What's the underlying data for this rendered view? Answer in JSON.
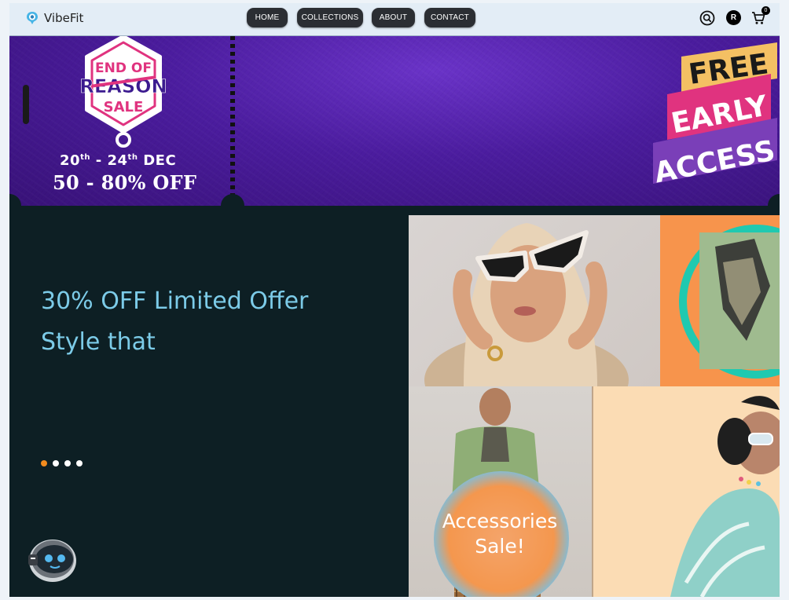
{
  "brand": {
    "name": "VibeFit"
  },
  "nav": {
    "items": [
      {
        "label": "HOME"
      },
      {
        "label": "COLLECTIONS"
      },
      {
        "label": "ABOUT"
      },
      {
        "label": "CONTACT"
      }
    ],
    "avatar_initial": "R",
    "cart_count": "0",
    "icons": [
      "search-icon",
      "cart-icon"
    ]
  },
  "banner": {
    "sale_title_line1": "END OF",
    "sale_title_line2": "REASON",
    "sale_title_line3": "SALE",
    "date_start": "20",
    "date_start_suffix": "th",
    "date_sep": " - ",
    "date_end": "24",
    "date_end_suffix": "th",
    "date_month": " DEC",
    "discount": "50 - 80% OFF",
    "badge_line1": "FREE",
    "badge_line2": "EARLY",
    "badge_line3": "ACCESS",
    "colors": {
      "purple": "#4b1c9e",
      "pink": "#e0337f",
      "yellow": "#f4c063",
      "violet": "#7a3fb8"
    }
  },
  "hero": {
    "headline_line1": "30% OFF Limited Offer",
    "headline_line2": "Style that",
    "carousel_dots": 4,
    "active_dot": 0,
    "promo": {
      "line1": "Accessories",
      "line2": "Sale!"
    },
    "colors": {
      "background": "#0d1f24",
      "headline": "#7ccbe8",
      "active_dot": "#f28c1e"
    }
  }
}
